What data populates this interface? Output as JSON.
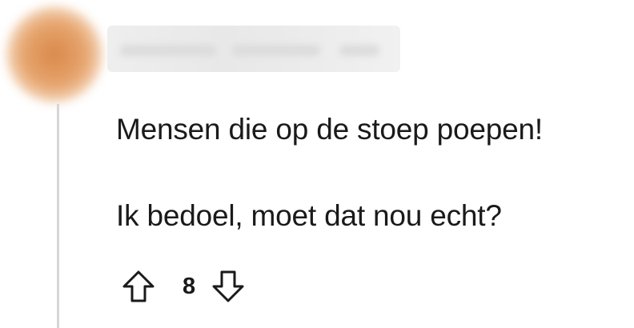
{
  "comment": {
    "body_lines": [
      "Mensen die op de stoep poepen!",
      "Ik bedoel, moet dat nou echt?"
    ],
    "score": "8",
    "icons": {
      "upvote": "arrow-up-icon",
      "downvote": "arrow-down-icon"
    },
    "colors": {
      "text": "#1a1a1b",
      "thread_line": "#d6d6d6",
      "avatar": "#e6a46d"
    }
  }
}
